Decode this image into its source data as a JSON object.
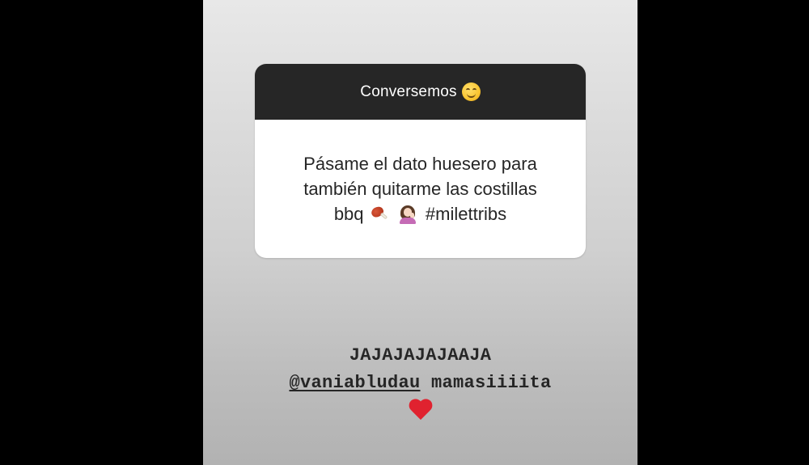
{
  "question_sticker": {
    "title": "Conversemos",
    "title_emoji": "smiling-face-icon",
    "question_line1": "Pásame el dato huesero para",
    "question_line2": "también quitarme las costillas",
    "question_line3_a": "bbq",
    "question_line3_emojis": [
      "meat-on-bone-icon",
      "woman-tipping-hand-icon"
    ],
    "question_line3_b": "#milettribs"
  },
  "reply": {
    "line1": "JAJAJAJAJAAJA",
    "mention": "@vaniabludau",
    "line2_rest": " mamasiiiita",
    "emoji": "red-heart-icon"
  },
  "colors": {
    "header_bg": "#262626",
    "card_bg": "#ffffff",
    "text": "#262626",
    "heart": "#e0222f"
  }
}
